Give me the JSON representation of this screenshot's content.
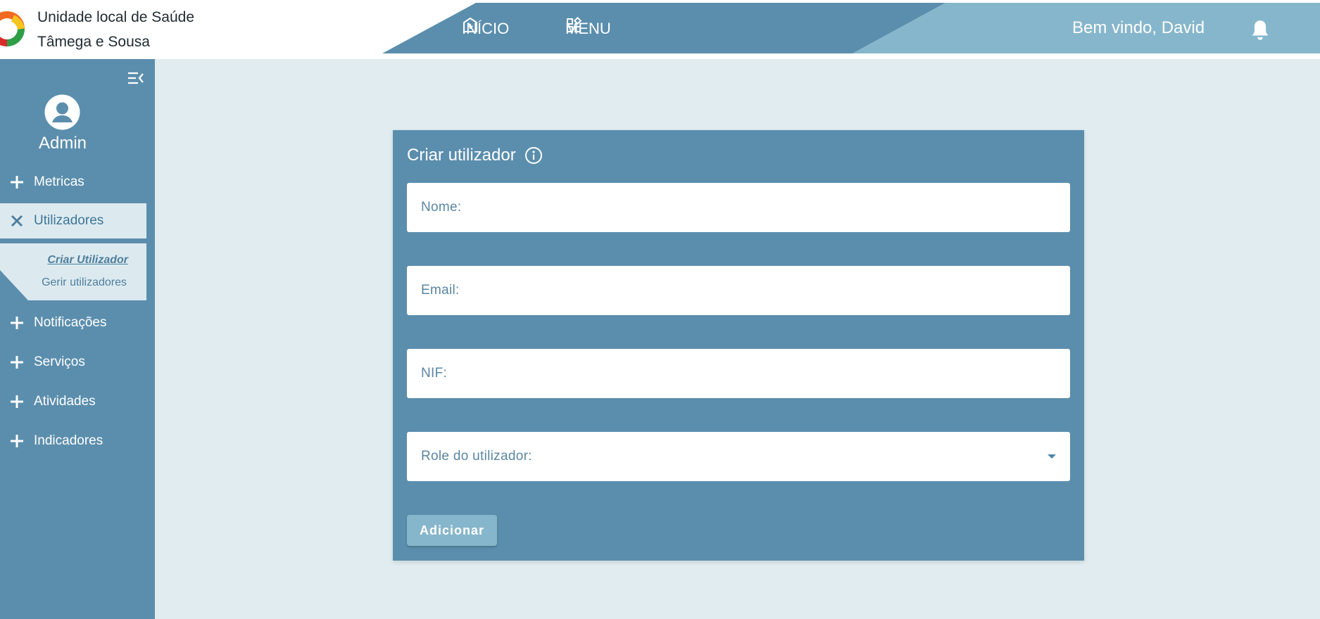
{
  "brand": {
    "line1": "Unidade local de Saúde",
    "line2": "Tâmega e Sousa"
  },
  "nav": {
    "inicio_label": "INÍCIO",
    "menu_label": "MENU",
    "inicio_icon": "hospital-plus-icon",
    "menu_icon": "grid-widgets-icon"
  },
  "user": {
    "welcome": "Bem vindo, David"
  },
  "sidebar": {
    "role": "Admin",
    "items": [
      {
        "label": "Metricas",
        "icon": "plus-icon",
        "expanded": false
      },
      {
        "label": "Utilizadores",
        "icon": "close-icon",
        "expanded": true,
        "children": [
          {
            "label": "Criar Utilizador",
            "current": true
          },
          {
            "label": "Gerir utilizadores",
            "current": false
          }
        ]
      },
      {
        "label": "Notificações",
        "icon": "plus-icon",
        "expanded": false
      },
      {
        "label": "Serviços",
        "icon": "plus-icon",
        "expanded": false
      },
      {
        "label": "Atividades",
        "icon": "plus-icon",
        "expanded": false
      },
      {
        "label": "Indicadores",
        "icon": "plus-icon",
        "expanded": false
      }
    ]
  },
  "form": {
    "title": "Criar utilizador",
    "fields": [
      {
        "label": "Nome:",
        "value": ""
      },
      {
        "label": "Email:",
        "value": ""
      },
      {
        "label": "NIF:",
        "value": ""
      },
      {
        "label": "Role do utilizador:",
        "value": "",
        "type": "select"
      }
    ],
    "submit_label": "Adicionar"
  },
  "colors": {
    "primary": "#5b8ead",
    "primary_light": "#86b6cb",
    "page_bg": "#e0ecf0",
    "active_item_bg": "#dceaf0"
  }
}
